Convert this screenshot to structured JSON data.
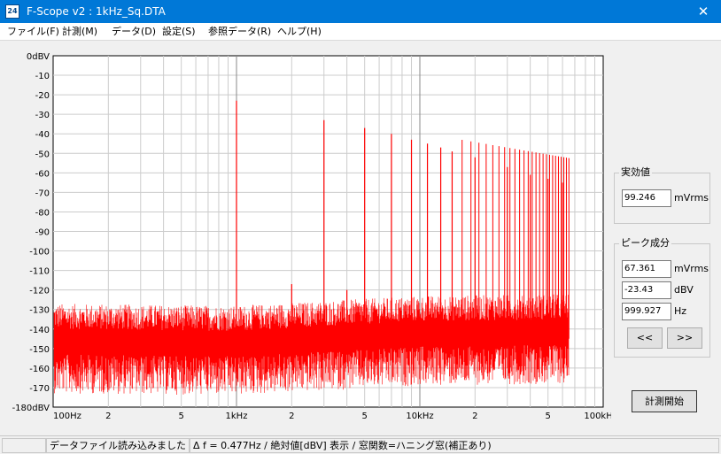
{
  "window": {
    "title": "F-Scope v2 : 1kHz_Sq.DTA",
    "icon_label": "24",
    "close_glyph": "✕"
  },
  "menu": [
    {
      "label": "ファイル(F)"
    },
    {
      "label": "計測(M)"
    },
    {
      "label": "データ(D)"
    },
    {
      "label": "設定(S)"
    },
    {
      "label": "参照データ(R)"
    },
    {
      "label": "ヘルプ(H)"
    }
  ],
  "chart_data": {
    "type": "line",
    "title": "",
    "xlabel": "",
    "ylabel": "",
    "x_scale": "log",
    "xlim": [
      100,
      100000
    ],
    "ylim": [
      -180,
      0
    ],
    "grid": true,
    "line_color": "#ff0000",
    "y_ticks": [
      "0dBV",
      "-10",
      "-20",
      "-30",
      "-40",
      "-50",
      "-60",
      "-70",
      "-80",
      "-90",
      "-100",
      "-110",
      "-120",
      "-130",
      "-140",
      "-150",
      "-160",
      "-170",
      "-180dBV"
    ],
    "x_ticks": [
      {
        "value": 100,
        "label": "100Hz"
      },
      {
        "value": 200,
        "label": "2"
      },
      {
        "value": 500,
        "label": "5"
      },
      {
        "value": 1000,
        "label": "1kHz"
      },
      {
        "value": 2000,
        "label": "2"
      },
      {
        "value": 5000,
        "label": "5"
      },
      {
        "value": 10000,
        "label": "10kHz"
      },
      {
        "value": 20000,
        "label": "2"
      },
      {
        "value": 50000,
        "label": "5"
      },
      {
        "value": 100000,
        "label": "100kHz"
      }
    ],
    "data_end_hz": 65000,
    "noise_floor": [
      {
        "hz": 100,
        "db": -145
      },
      {
        "hz": 1000,
        "db": -146
      },
      {
        "hz": 10000,
        "db": -141
      },
      {
        "hz": 65000,
        "db": -140
      }
    ],
    "harmonics": [
      {
        "hz": 1000,
        "db": -23
      },
      {
        "hz": 2000,
        "db": -117
      },
      {
        "hz": 3000,
        "db": -33
      },
      {
        "hz": 4000,
        "db": -120
      },
      {
        "hz": 5000,
        "db": -37
      },
      {
        "hz": 7000,
        "db": -40
      },
      {
        "hz": 9000,
        "db": -43
      },
      {
        "hz": 11000,
        "db": -45
      },
      {
        "hz": 13000,
        "db": -47
      },
      {
        "hz": 15000,
        "db": -49
      },
      {
        "hz": 20000,
        "db": -52
      },
      {
        "hz": 30000,
        "db": -57
      },
      {
        "hz": 40000,
        "db": -61
      },
      {
        "hz": 50000,
        "db": -63
      },
      {
        "hz": 60000,
        "db": -65
      }
    ]
  },
  "rms_panel": {
    "title": "実効値",
    "value": "99.246",
    "unit": "mVrms"
  },
  "peak_panel": {
    "title": "ピーク成分",
    "mvrms_value": "67.361",
    "mvrms_unit": "mVrms",
    "dbv_value": "-23.43",
    "dbv_unit": "dBV",
    "hz_value": "999.927",
    "hz_unit": "Hz",
    "prev_label": "<<",
    "next_label": ">>"
  },
  "start_button": {
    "label": "計測開始"
  },
  "status": {
    "message": "データファイル読み込みました",
    "info": "Δ f = 0.477Hz / 絶対値[dBV] 表示 / 窓関数=ハニング窓(補正あり)"
  }
}
